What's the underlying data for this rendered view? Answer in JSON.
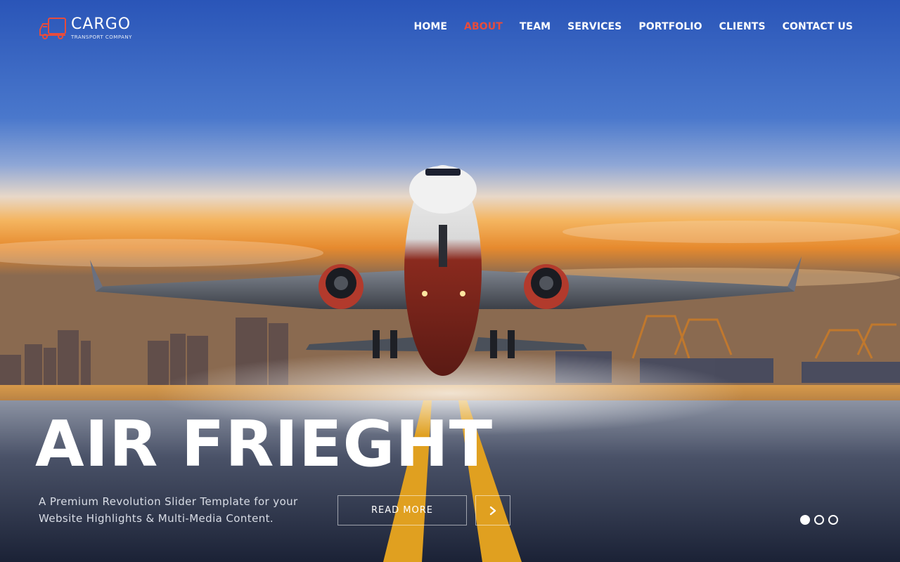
{
  "brand": {
    "title": "CARGO",
    "subtitle": "TRANSPORT COMPANY",
    "icon": "truck-icon",
    "accent_color": "#e74c3c"
  },
  "nav": {
    "items": [
      {
        "label": "HOME",
        "active": false
      },
      {
        "label": "ABOUT",
        "active": true
      },
      {
        "label": "TEAM",
        "active": false
      },
      {
        "label": "SERVICES",
        "active": false
      },
      {
        "label": "PORTFOLIO",
        "active": false
      },
      {
        "label": "CLIENTS",
        "active": false
      },
      {
        "label": "CONTACT US",
        "active": false
      }
    ]
  },
  "slide": {
    "title": "AIR FRIEGHT",
    "description": "A Premium Revolution Slider Template for your Website Highlights & Multi-Media Content.",
    "button_label": "READ MORE",
    "next_icon": "chevron-right-icon",
    "current_index": 1,
    "total_slides": 3
  }
}
